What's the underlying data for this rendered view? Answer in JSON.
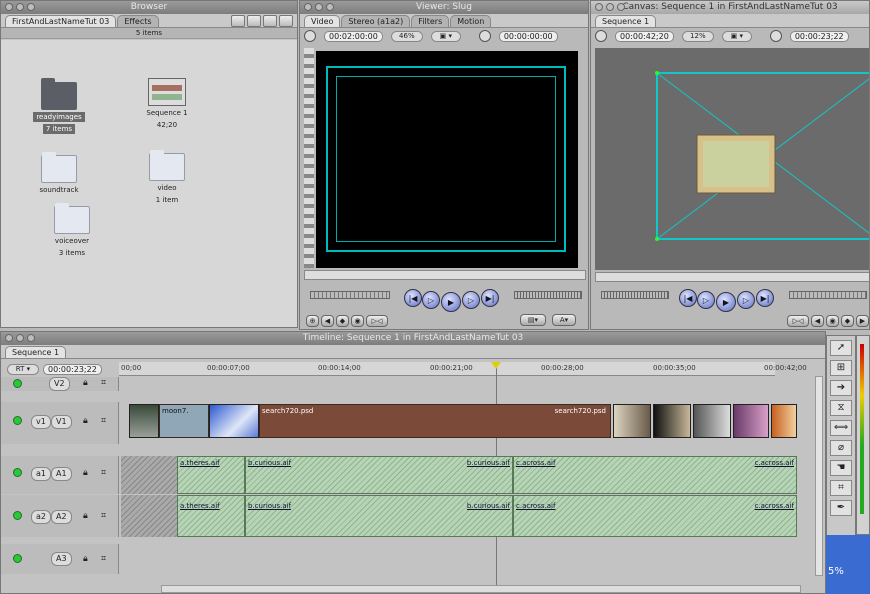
{
  "browser": {
    "title": "Browser",
    "tabs": [
      "FirstAndLastNameTut 03",
      "Effects"
    ],
    "item_count": "5 items",
    "items": [
      {
        "name": "readyimages",
        "sub": "7 items"
      },
      {
        "name": "Sequence 1",
        "sub": "42;20"
      },
      {
        "name": "soundtrack",
        "sub": ""
      },
      {
        "name": "video",
        "sub": "1 item"
      },
      {
        "name": "voiceover",
        "sub": "3 items"
      }
    ]
  },
  "viewer": {
    "title": "Viewer: Slug",
    "tabs": [
      "Video",
      "Stereo (a1a2)",
      "Filters",
      "Motion"
    ],
    "duration": "00:02:00:00",
    "zoom": "46%",
    "timecode": "00:00:00:00"
  },
  "canvas": {
    "title": "Canvas: Sequence 1 in FirstAndLastNameTut 03",
    "tab": "Sequence 1",
    "duration": "00:00:42;20",
    "zoom": "12%",
    "timecode": "00:00:23;22"
  },
  "timeline": {
    "title": "Timeline: Sequence 1 in FirstAndLastNameTut 03",
    "tab": "Sequence 1",
    "rt_label": "RT",
    "current_time": "00:00:23;22",
    "ruler": [
      "00;00",
      "00:00:07;00",
      "00:00:14;00",
      "00:00:21;00",
      "00:00:28;00",
      "00:00:35;00",
      "00:00:42;00"
    ],
    "tracks": [
      {
        "src": "",
        "dest": "V2"
      },
      {
        "src": "v1",
        "dest": "V1"
      },
      {
        "src": "a1",
        "dest": "A1"
      },
      {
        "src": "a2",
        "dest": "A2"
      },
      {
        "src": "",
        "dest": "A3"
      }
    ],
    "video_clips": [
      "moon7.",
      "search720.psd",
      "search720.psd"
    ],
    "audio_clips": [
      "a.theres.aif",
      "b.curious.aif",
      "b.curious.aif",
      "c.across.aif",
      "c.across.aif"
    ]
  },
  "status": {
    "zoom_readout": "5%"
  },
  "colors": {
    "accent_cyan": "#11c7c7",
    "clip_brown": "#7b4a39",
    "audio_green": "#9fc49f"
  }
}
